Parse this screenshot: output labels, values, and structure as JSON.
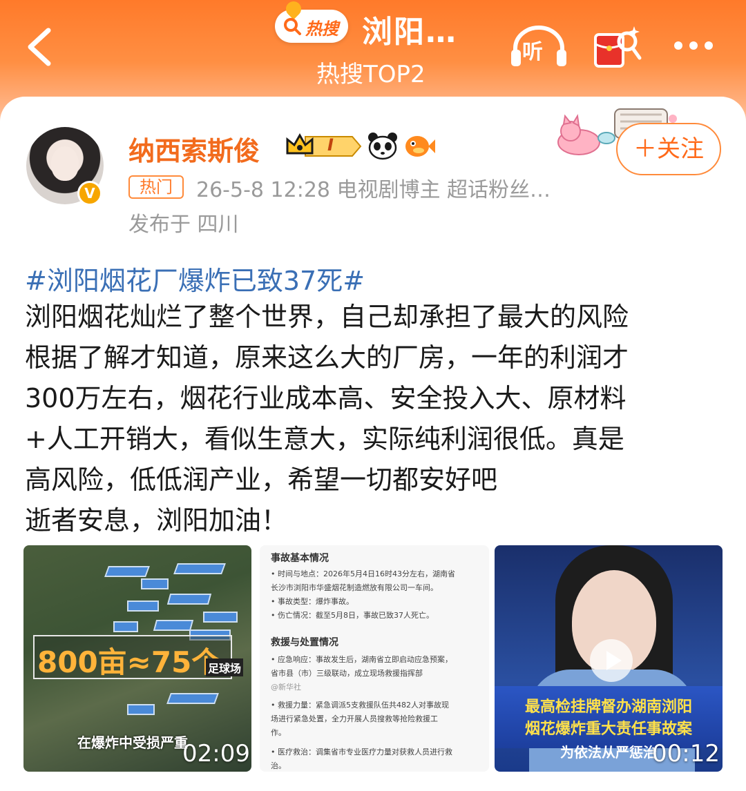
{
  "header": {
    "pill_label": "热搜",
    "title": "浏阳…",
    "subtitle": "热搜TOP2",
    "listen_label": "听"
  },
  "post": {
    "username": "纳西索斯俊",
    "vip_level": "I",
    "follow_label": "＋关注",
    "hot_tag": "热门",
    "meta": "26-5-8 12:28  电视剧博主 超话粉丝…",
    "location": "发布于 四川",
    "hashtag": "#浏阳烟花厂爆炸已致37死#",
    "body_lines": [
      "浏阳烟花灿烂了整个世界，自己却承担了最大的风险",
      "根据了解才知道，原来这么大的厂房，一年的利润才",
      "300万左右，烟花行业成本高、安全投入大、原材料",
      "+人工开销大，看似生意大，实际纯利润很低。真是",
      "高风险，低低润产业，希望一切都安好吧",
      "逝者安息，浏阳加油！"
    ]
  },
  "media": {
    "video1": {
      "overlay": "800亩≈75个",
      "overlay_small": "足球场",
      "caption": "在爆炸中受损严重",
      "duration": "02:09"
    },
    "doc": {
      "heading1": "事故基本情况",
      "lines1": [
        "• 时间与地点：2026年5月4日16时43分左右，湖南省",
        "长沙市浏阳市华盛烟花制造燃放有限公司一车间。",
        "• 事故类型：爆炸事故。",
        "• 伤亡情况：截至5月8日，事故已致37人死亡。"
      ],
      "heading2": "救援与处置情况",
      "lines2": [
        "• 应急响应：事故发生后，湖南省立即启动应急预案，",
        "省市县（市）三级联动，成立现场救援指挥部",
        "@新华社",
        "• 救援力量：紧急调派5支救援队伍共482人对事故现",
        "场进行紧急处置，全力开展人员搜救等抢险救援工",
        "作。",
        "• 医疗救治：调集省市专业医疗力量对获救人员进行救",
        "治。"
      ]
    },
    "video2": {
      "line1": "最高检挂牌督办湖南浏阳",
      "line2": "烟花爆炸重大责任事故案",
      "line3": "为依法从严惩治",
      "duration": "00:12"
    }
  }
}
